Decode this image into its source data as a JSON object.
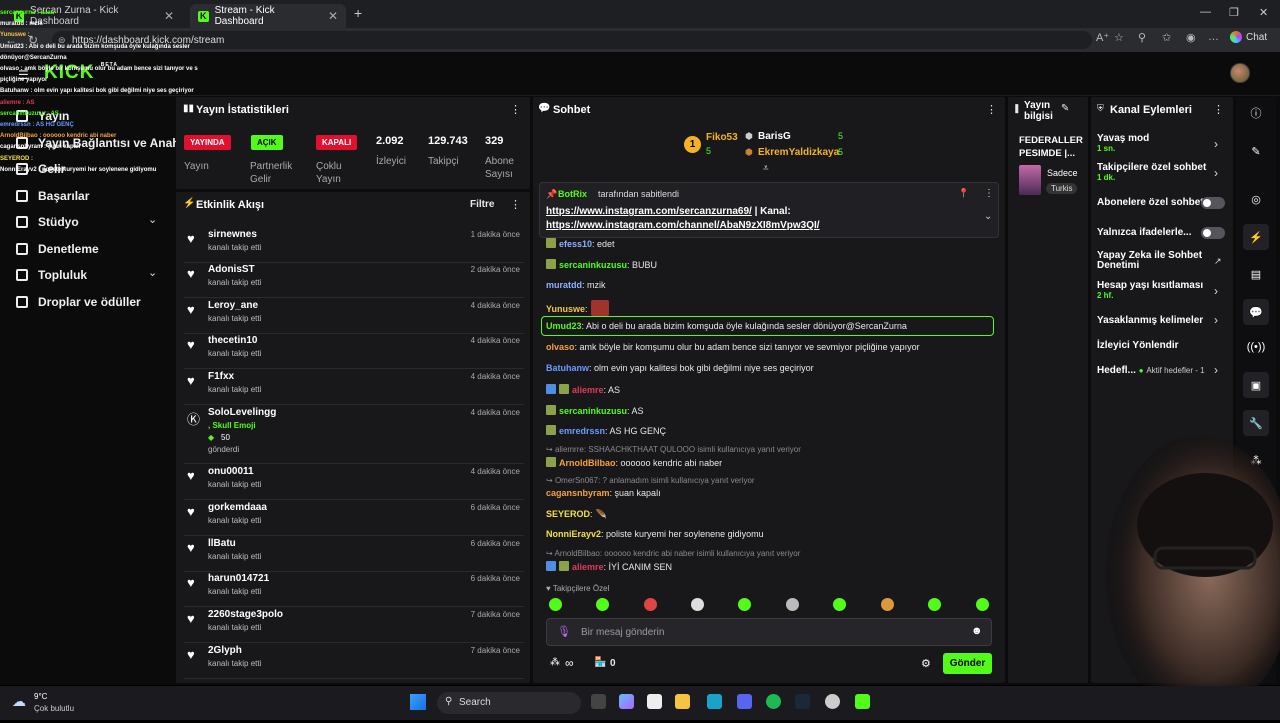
{
  "browser": {
    "tabs": [
      {
        "title": "Sercan Zurna - Kick Dashboard",
        "close": "✕"
      },
      {
        "title": "Stream - Kick Dashboard",
        "close": "✕"
      }
    ],
    "new_tab": "+",
    "url": "https://dashboard.kick.com/stream",
    "chat_label": "Chat"
  },
  "app": {
    "logo": "KICK",
    "logo_badge": "BETA"
  },
  "sidebar": {
    "items": [
      {
        "label": "Yayın",
        "icon": "stream-icon"
      },
      {
        "label": "Yayın Bağlantısı ve Anahtarı",
        "icon": "key-icon"
      },
      {
        "label": "Gelir",
        "icon": "money-icon"
      },
      {
        "label": "Başarılar",
        "icon": "trophy-icon"
      },
      {
        "label": "Stüdyo",
        "icon": "studio-icon",
        "expand": "⌄"
      },
      {
        "label": "Denetleme",
        "icon": "shield-icon"
      },
      {
        "label": "Topluluk",
        "icon": "community-icon",
        "expand": "⌄"
      },
      {
        "label": "Droplar ve ödüller",
        "icon": "gift-icon"
      }
    ]
  },
  "stats": {
    "title": "Yayın İstatistikleri",
    "menu": "⋮",
    "badges": [
      {
        "value": "YAYINDA",
        "label_1": "Yayın",
        "label_2": ""
      },
      {
        "value": "AÇIK",
        "label_1": "Partnerlik",
        "label_2": "Gelir"
      },
      {
        "value": "KAPALI",
        "label_1": "Çoklu",
        "label_2": "Yayın"
      }
    ],
    "numbers": [
      {
        "value": "2.092",
        "label_1": "İzleyici",
        "label_2": ""
      },
      {
        "value": "129.743",
        "label_1": "Takipçi",
        "label_2": ""
      },
      {
        "value": "329",
        "label_1": "Abone",
        "label_2": "Sayısı"
      }
    ],
    "colors": {
      "live": "#e0102e",
      "on": "#53fc18",
      "off": "#e0102e"
    }
  },
  "activity": {
    "title": "Etkinlik Akışı",
    "filter": "Filtre",
    "menu": "⋮",
    "items": [
      {
        "name": "sirnewnes",
        "sub": "kanalı takip etti",
        "time": "1 dakika önce"
      },
      {
        "name": "AdonisST",
        "sub": "kanalı takip etti",
        "time": "2 dakika önce"
      },
      {
        "name": "Leroy_ane",
        "sub": "kanalı takip etti",
        "time": "4 dakika önce"
      },
      {
        "name": "thecetin10",
        "sub": "kanalı takip etti",
        "time": "4 dakika önce"
      },
      {
        "name": "F1fxx",
        "sub": "kanalı takip etti",
        "time": "4 dakika önce"
      },
      {
        "name": "onu00011",
        "sub": "kanalı takip etti",
        "time": "4 dakika önce"
      },
      {
        "name": "gorkemdaaa",
        "sub": "kanalı takip etti",
        "time": "6 dakika önce"
      },
      {
        "name": "llBatu",
        "sub": "kanalı takip etti",
        "time": "6 dakika önce"
      },
      {
        "name": "harun014721",
        "sub": "kanalı takip etti",
        "time": "6 dakika önce"
      },
      {
        "name": "2260stage3polo",
        "sub": "kanalı takip etti",
        "time": "7 dakika önce"
      },
      {
        "name": "2Glyph",
        "sub": "kanalı takip etti",
        "time": "7 dakika önce"
      }
    ],
    "special": {
      "name": "SoloLevelingg",
      "line": ", Skull Emoji",
      "amount": "50",
      "sent": "gönderdi",
      "time": "4 dakika önce"
    }
  },
  "chat": {
    "title": "Sohbet",
    "menu": "⋮",
    "leaderboard": [
      {
        "rank": "1",
        "name": "Fiko53",
        "count": "5"
      },
      {
        "rank": "",
        "name": "BarisG",
        "count": "5"
      },
      {
        "rank": "",
        "name": "EkremYaldizkaya",
        "count": "5"
      }
    ],
    "pinned": {
      "by": "BotRix",
      "by_suffix": "tarafından sabitlendi",
      "line1_link": "https://www.instagram.com/sercanzurna69/",
      "line1_rest": " | Kanal:",
      "line2_link": "https://www.instagram.com/channel/AbaN9zXI8mVpw3QI/"
    },
    "messages": [
      {
        "user": "efess10",
        "text": ": edet",
        "color": "#8fb0ff"
      },
      {
        "user": "sercaninkuzusu",
        "text": ": BUBU",
        "color": "#53fc18"
      },
      {
        "user": "muratdd",
        "text": ": mzik",
        "color": "#8fb0ff"
      },
      {
        "user": "Yunuswe",
        "text": ":",
        "color": "#f5c542"
      },
      {
        "user": "Umud23",
        "text": ": Abi o deli bu arada bizim komşuda öyle kulağında sesler dönüyor@SercanZurna",
        "color": "#53fc18"
      },
      {
        "user": "olvaso",
        "text": ": amk böyle bir komşumu olur bu adam bence sizi tanıyor ve sevmiyor piçliğine yapıyor",
        "color": "#f5a142"
      },
      {
        "user": "Batuhanw",
        "text": ": olm evin yapı kalitesi bok gibi değilmi niye ses geçiriyor",
        "color": "#6a9bff"
      },
      {
        "user": "aliemre",
        "text": ": AS",
        "color": "#e23a5a"
      },
      {
        "user": "sercaninkuzusu",
        "text": ": AS",
        "color": "#53fc18"
      },
      {
        "user": "emredrssn",
        "text": ": AS HG GENÇ",
        "color": "#6a9bff"
      },
      {
        "user": "ArnoldBilbao",
        "text": ": oooooo kendric abi naber",
        "color": "#f5a142",
        "reply": "aliemrre: SSHAACHKTHAAT QULOOO isimli kullanıcıya yanıt veriyor"
      },
      {
        "user": "cagansnbyram",
        "text": ": şuan kapalı",
        "color": "#f5a142",
        "reply": "OmerSn067: ? anlamadım isimli kullanıcıya yanıt veriyor"
      },
      {
        "user": "SEYEROD",
        "text": ":",
        "color": "#f5e142"
      },
      {
        "user": "NonniErayv2",
        "text": ": poliste kuryemi her soylenene gidiyomu",
        "color": "#f5e142"
      },
      {
        "user": "aliemre",
        "text": ": İYİ CANIM SEN",
        "color": "#e23a5a",
        "reply": "ArnoldBilbao: oooooo kendric abi naber isimli kullanıcıya yanıt veriyor"
      }
    ],
    "emote_group": "Takipçilere Özel",
    "input_placeholder": "Bir mesaj gönderin",
    "points": "∞",
    "store_count": "0",
    "send": "Gönder"
  },
  "info": {
    "title": "Yayın bilgisi",
    "stream_title": "FEDERALLER PESIMDE |...",
    "category": "Sadece",
    "language": "Turkis"
  },
  "actions": {
    "title": "Kanal Eylemleri",
    "menu": "⋮",
    "items": [
      {
        "label": "Yavaş mod",
        "sub": "1 sn."
      },
      {
        "label": "Takipçilere özel sohbet",
        "sub": "1 dk."
      },
      {
        "label": "Abonelere özel sohbet",
        "sub": ""
      },
      {
        "label": "Yalnızca ifadelerle...",
        "sub": ""
      },
      {
        "label": "Yapay Zeka ile Sohbet Denetimi",
        "sub": ""
      },
      {
        "label": "Hesap yaşı kısıtlaması",
        "sub": "2 hf."
      },
      {
        "label": "Yasaklanmış kelimeler",
        "sub": ""
      },
      {
        "label": "İzleyici Yönlendir",
        "sub": ""
      },
      {
        "label": "Hedefl...",
        "sub": "Aktif hedefler - 1"
      }
    ]
  },
  "overlay": {
    "lines": [
      "sercanzurna : aaaa",
      "muratdd : mzik",
      "Yunuswe :",
      "Umud23 : Abi o deli bu arada bizim komşuda öyle kulağında sesler",
      "dönüyor@SercanZurna",
      "olvaso : amk böyle bir komşumu olur bu adam bence sizi tanıyor ve s",
      "piçliğine yapıyor",
      "Batuhanw : olm evin yapı kalitesi bok gibi değilmi niye ses geçiriyor",
      "aliemre : AS",
      "sercaninkuzusu : AS",
      "emredrssn : AS HG GENÇ",
      "ArnoldBilbao : oooooo kendric abi naber",
      "cagansnbyram : şuan kapalı",
      "SEYEROD :",
      "NonniErayv2 : poliste kuryemi her soylenene gidiyomu"
    ]
  },
  "taskbar": {
    "temp": "9°C",
    "weather": "Çok bulutlu",
    "search": "Search"
  }
}
